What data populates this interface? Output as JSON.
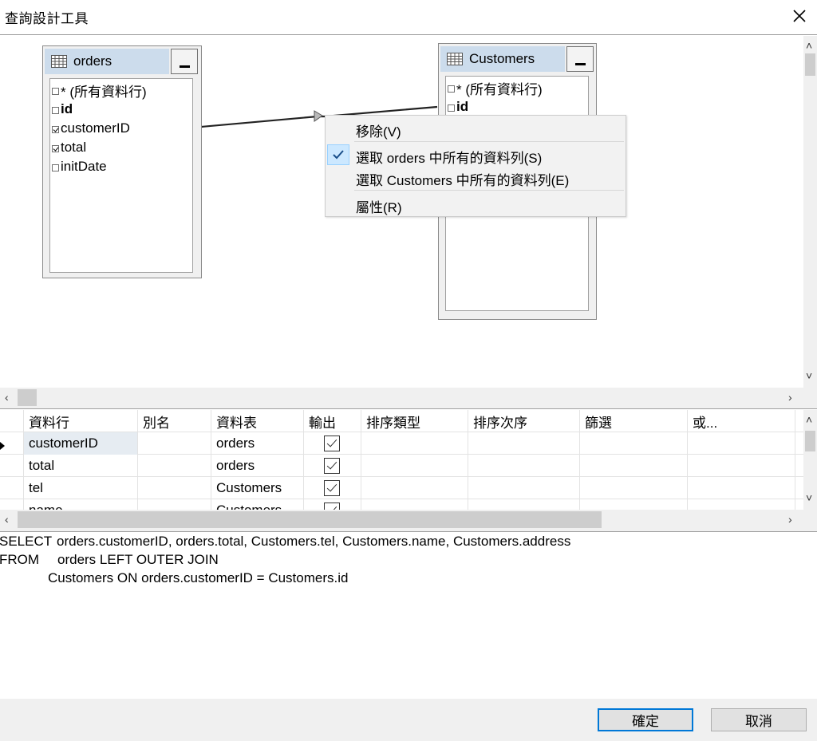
{
  "window": {
    "title": "查詢設計工具"
  },
  "tables": [
    {
      "name": "orders",
      "columns": [
        {
          "label": "* (所有資料行)",
          "checked": false,
          "bold": false
        },
        {
          "label": "id",
          "checked": false,
          "bold": true
        },
        {
          "label": "customerID",
          "checked": true,
          "bold": false
        },
        {
          "label": "total",
          "checked": true,
          "bold": false
        },
        {
          "label": "initDate",
          "checked": false,
          "bold": false
        }
      ]
    },
    {
      "name": "Customers",
      "columns": [
        {
          "label": "* (所有資料行)",
          "checked": false,
          "bold": false
        },
        {
          "label": "id",
          "checked": false,
          "bold": true
        }
      ]
    }
  ],
  "context_menu": {
    "items": [
      {
        "label": "移除(V)",
        "checked": false
      },
      {
        "label": "選取 orders 中所有的資料列(S)",
        "checked": true
      },
      {
        "label": "選取 Customers 中所有的資料列(E)",
        "checked": false
      },
      {
        "label": "屬性(R)",
        "checked": false
      }
    ]
  },
  "grid": {
    "headers": [
      "資料行",
      "別名",
      "資料表",
      "輸出",
      "排序類型",
      "排序次序",
      "篩選",
      "或..."
    ],
    "rows": [
      {
        "column": "customerID",
        "alias": "",
        "table": "orders",
        "output": true
      },
      {
        "column": "total",
        "alias": "",
        "table": "orders",
        "output": true
      },
      {
        "column": "tel",
        "alias": "",
        "table": "Customers",
        "output": true
      },
      {
        "column": "name",
        "alias": "",
        "table": "Customers",
        "output": true
      }
    ]
  },
  "sql": {
    "line1_keyword": "SELECT",
    "line1_text": "orders.customerID, orders.total, Customers.tel, Customers.name, Customers.address",
    "line2_keyword": "FROM",
    "line2_text": "orders LEFT OUTER JOIN",
    "line3_text": "Customers ON orders.customerID = Customers.id"
  },
  "buttons": {
    "ok": "確定",
    "cancel": "取消"
  },
  "colors": {
    "table_header": "#ccdcec",
    "menu_highlight": "#cce8ff",
    "accent": "#0078d7"
  }
}
